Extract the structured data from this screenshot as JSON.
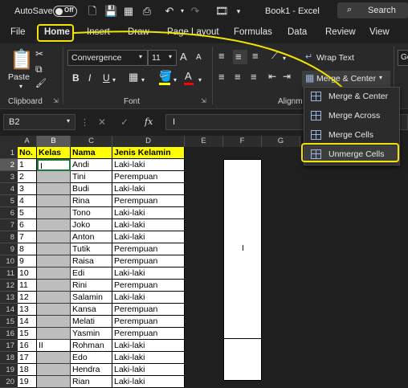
{
  "titlebar": {
    "autosave_label": "AutoSave",
    "autosave_state": "Off",
    "doc_title": "Book1 - Excel",
    "search_label": "Search"
  },
  "tabs": [
    "File",
    "Home",
    "Insert",
    "Draw",
    "Page Layout",
    "Formulas",
    "Data",
    "Review",
    "View"
  ],
  "ribbon": {
    "paste_label": "Paste",
    "font_name": "Convergence",
    "font_size": "11",
    "wrap_text": "Wrap Text",
    "merge_center": "Merge & Center",
    "groups": {
      "clipboard": "Clipboard",
      "font": "Font",
      "alignment": "Alignm"
    },
    "bold": "B",
    "italic": "I",
    "underline": "U",
    "grow_font": "A",
    "shrink_font": "A",
    "fill_color": "#ffff00",
    "font_color": "#ff0000",
    "cut_glyph": "✂",
    "copy_glyph": "⧉",
    "painter_glyph": "🖌",
    "number_format": "Ge"
  },
  "formula_bar": {
    "name_box": "B2",
    "fx": "fx",
    "content": "I"
  },
  "dropdown": {
    "items": [
      "Merge & Center",
      "Merge Across",
      "Merge Cells",
      "Unmerge Cells"
    ]
  },
  "columns": [
    "A",
    "B",
    "C",
    "D",
    "E",
    "F",
    "G"
  ],
  "headers": [
    "No.",
    "Kelas",
    "Nama",
    "Jenis Kelamin"
  ],
  "rows": [
    {
      "no": "1",
      "kelas": "I",
      "nama": "Andi",
      "jk": "Laki-laki"
    },
    {
      "no": "2",
      "kelas": "",
      "nama": "Tini",
      "jk": "Perempuan"
    },
    {
      "no": "3",
      "kelas": "",
      "nama": "Budi",
      "jk": "Laki-laki"
    },
    {
      "no": "4",
      "kelas": "",
      "nama": "Rina",
      "jk": "Perempuan"
    },
    {
      "no": "5",
      "kelas": "",
      "nama": "Tono",
      "jk": "Laki-laki"
    },
    {
      "no": "6",
      "kelas": "",
      "nama": "Joko",
      "jk": "Laki-laki"
    },
    {
      "no": "7",
      "kelas": "",
      "nama": "Anton",
      "jk": "Laki-laki"
    },
    {
      "no": "8",
      "kelas": "",
      "nama": "Tutik",
      "jk": "Perempuan"
    },
    {
      "no": "9",
      "kelas": "",
      "nama": "Raisa",
      "jk": "Perempuan"
    },
    {
      "no": "10",
      "kelas": "",
      "nama": "Edi",
      "jk": "Laki-laki"
    },
    {
      "no": "11",
      "kelas": "",
      "nama": "Rini",
      "jk": "Perempuan"
    },
    {
      "no": "12",
      "kelas": "",
      "nama": "Salamin",
      "jk": "Laki-laki"
    },
    {
      "no": "13",
      "kelas": "",
      "nama": "Kansa",
      "jk": "Perempuan"
    },
    {
      "no": "14",
      "kelas": "",
      "nama": "Melati",
      "jk": "Perempuan"
    },
    {
      "no": "15",
      "kelas": "",
      "nama": "Yasmin",
      "jk": "Perempuan"
    },
    {
      "no": "16",
      "kelas": "II",
      "nama": "Rohman",
      "jk": "Laki-laki"
    },
    {
      "no": "17",
      "kelas": "",
      "nama": "Edo",
      "jk": "Laki-laki"
    },
    {
      "no": "18",
      "kelas": "",
      "nama": "Hendra",
      "jk": "Laki-laki"
    },
    {
      "no": "19",
      "kelas": "",
      "nama": "Rian",
      "jk": "Laki-laki"
    }
  ],
  "row_numbers": [
    "1",
    "2",
    "3",
    "4",
    "5",
    "6",
    "7",
    "8",
    "9",
    "10",
    "11",
    "12",
    "13",
    "14",
    "15",
    "16",
    "17",
    "18",
    "19",
    "20"
  ],
  "merged_f_label": "I",
  "highlight_color": "#f2e300"
}
